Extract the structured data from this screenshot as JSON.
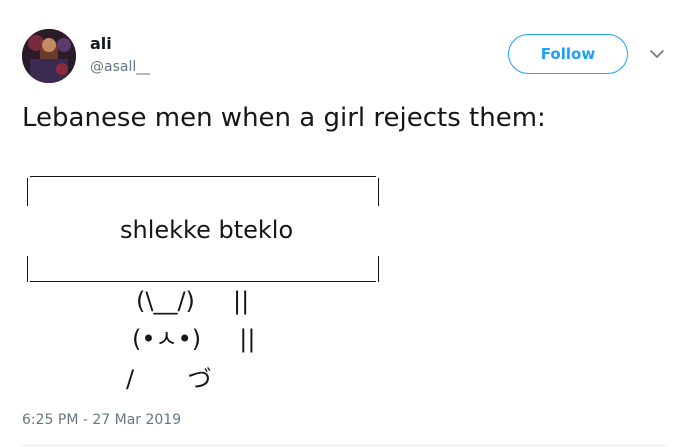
{
  "author": {
    "display_name": "ali",
    "handle": "@asall__"
  },
  "actions": {
    "follow_label": "Follow",
    "menu_icon": "chevron-down-icon"
  },
  "tweet": {
    "text": "Lebanese men when a girl rejects them:",
    "sign_text": "shlekke bteklo",
    "ascii_rows": [
      "(\\__/)     ||",
      "(•ㅅ•)     ||",
      "/       づ"
    ],
    "timestamp": "6:25 PM - 27 Mar 2019"
  },
  "colors": {
    "accent": "#1da1f2",
    "text": "#14171a",
    "muted": "#657786",
    "divider": "#e6ecf0"
  }
}
